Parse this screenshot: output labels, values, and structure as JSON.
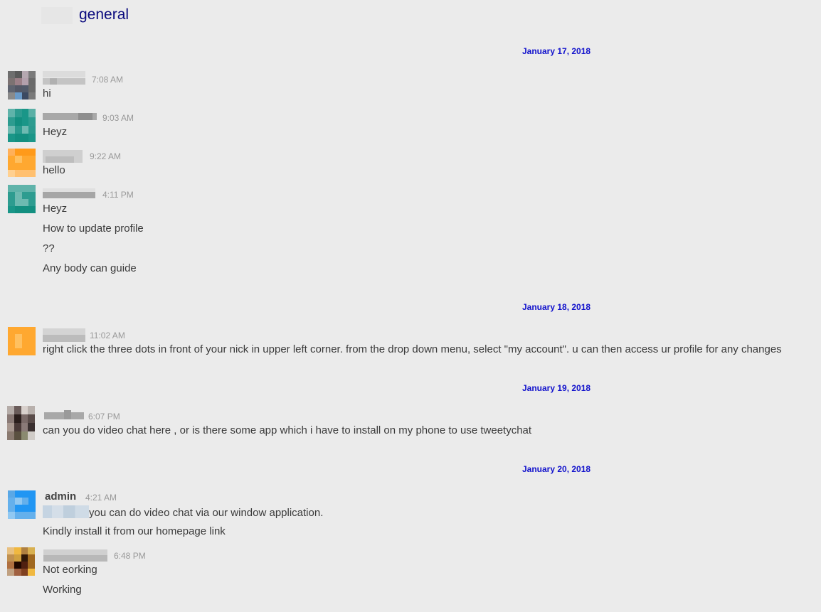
{
  "header": {
    "channel_title": "general"
  },
  "dates": {
    "d1": "January 17, 2018",
    "d2": "January 18, 2018",
    "d3": "January 19, 2018",
    "d4": "January 20, 2018"
  },
  "messages": [
    {
      "time": "7:08 AM",
      "lines": [
        "hi"
      ]
    },
    {
      "time": "9:03 AM",
      "lines": [
        "Heyz"
      ]
    },
    {
      "time": "9:22 AM",
      "lines": [
        "hello"
      ]
    },
    {
      "time": "4:11 PM",
      "lines": [
        "Heyz",
        "How to update profile",
        "??",
        "Any body can guide"
      ]
    },
    {
      "time": "11:02 AM",
      "lines": [
        "right click the three dots in front of your nick in upper left corner. from the drop down menu, select \"my account\". u can then access ur profile for any changes"
      ]
    },
    {
      "time": "6:07 PM",
      "lines": [
        "can you do video chat here , or is there some app which i have to install on my phone to use tweetychat"
      ]
    },
    {
      "author": "admin",
      "time": "4:21 AM",
      "lines": [
        "you can do video chat via our window application.",
        "Kindly install it from our homepage link"
      ]
    },
    {
      "time": "6:48 PM",
      "lines": [
        "Not eorking",
        "Working"
      ]
    }
  ],
  "colors": {
    "channel_title": "#0a0a7e",
    "date_separator": "#1111cc",
    "timestamp": "#999999",
    "message_text": "#3a3a3a",
    "background": "#ebebeb"
  }
}
